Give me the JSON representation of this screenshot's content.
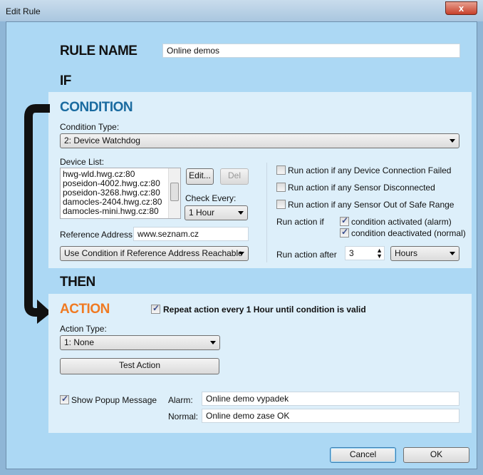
{
  "window": {
    "title": "Edit Rule",
    "close": "x"
  },
  "rule_name": {
    "label": "RULE NAME",
    "value": "Online demos"
  },
  "if_label": "IF",
  "condition": {
    "heading": "CONDITION",
    "type_label": "Condition Type:",
    "type_value": "2: Device Watchdog",
    "device_list_label": "Device List:",
    "devices": [
      "hwg-wld.hwg.cz:80",
      "poseidon-4002.hwg.cz:80",
      "poseidon-3268.hwg.cz:80",
      "damocles-2404.hwg.cz:80",
      "damocles-mini.hwg.cz:80"
    ],
    "edit": "Edit...",
    "del": "Del",
    "check_every_label": "Check Every:",
    "check_every_value": "1 Hour",
    "ref_label": "Reference Address:",
    "ref_value": "www.seznam.cz",
    "ref_mode": "Use Condition if Reference Address Reachable",
    "opt_conn_failed": "Run action if any Device Connection Failed",
    "opt_disconnected": "Run action if any Sensor Disconnected",
    "opt_out_of_range": "Run action if any Sensor Out of Safe Range",
    "run_if_label": "Run action if",
    "activated": "condition activated (alarm)",
    "deactivated": "condition deactivated (normal)",
    "run_after_label": "Run action after",
    "run_after_value": "3",
    "run_after_unit": "Hours"
  },
  "then_label": "THEN",
  "action": {
    "heading": "ACTION",
    "repeat": "Repeat action every 1 Hour until condition is valid",
    "type_label": "Action Type:",
    "type_value": "1: None",
    "test": "Test Action",
    "popup": "Show Popup Message",
    "alarm_label": "Alarm:",
    "alarm_value": "Online demo vypadek",
    "normal_label": "Normal:",
    "normal_value": "Online demo zase OK"
  },
  "buttons": {
    "cancel": "Cancel",
    "ok": "OK"
  },
  "colors": {
    "condition": "#1a6ba0",
    "action": "#f07a22",
    "background": "#acd8f4"
  }
}
